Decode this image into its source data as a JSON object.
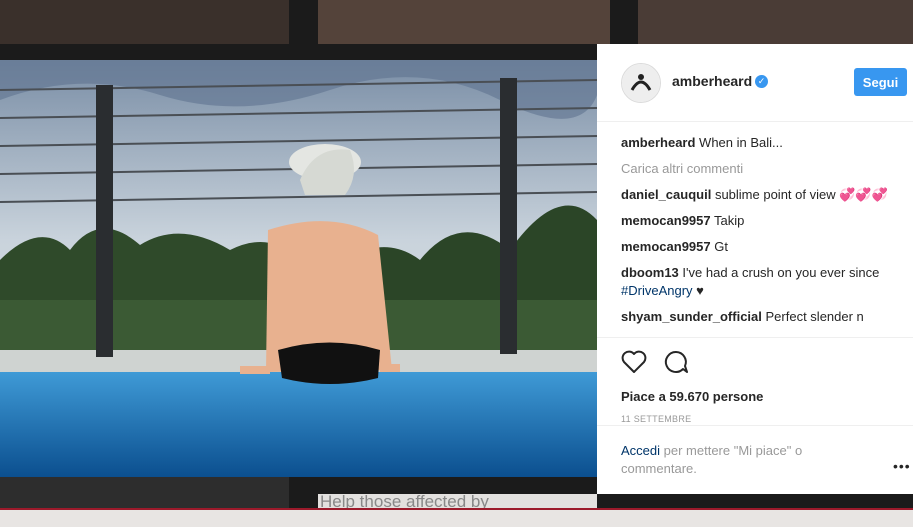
{
  "post": {
    "username": "amberheard",
    "follow_label": "Segui",
    "caption_user": "amberheard",
    "caption_text": "When in Bali...",
    "load_more": "Carica altri commenti",
    "comments": [
      {
        "user": "daniel_cauquil",
        "text": "sublime point of view 💞💞💞"
      },
      {
        "user": "memocan9957",
        "text": "Takip"
      },
      {
        "user": "memocan9957",
        "text": "Gt"
      },
      {
        "user": "dboom13",
        "text": "I've had a crush on you ever since ",
        "tag": "#DriveAngry",
        "after": " ♥"
      },
      {
        "user": "shyam_sunder_official",
        "text": "Perfect slender n"
      }
    ],
    "likes": "Piace a 59.670 persone",
    "date": "11 SETTEMBRE",
    "login_link": "Accedi",
    "login_rest": " per mettere \"Mi piace\" o commentare.",
    "more": "•••"
  },
  "background": {
    "bottom_text": "Help those affected by"
  },
  "icons": [
    "verified-badge-icon",
    "heart-icon",
    "comment-icon",
    "more-options-icon"
  ],
  "colors": {
    "accent": "#3897f0",
    "link": "#003569",
    "muted": "#999999"
  }
}
